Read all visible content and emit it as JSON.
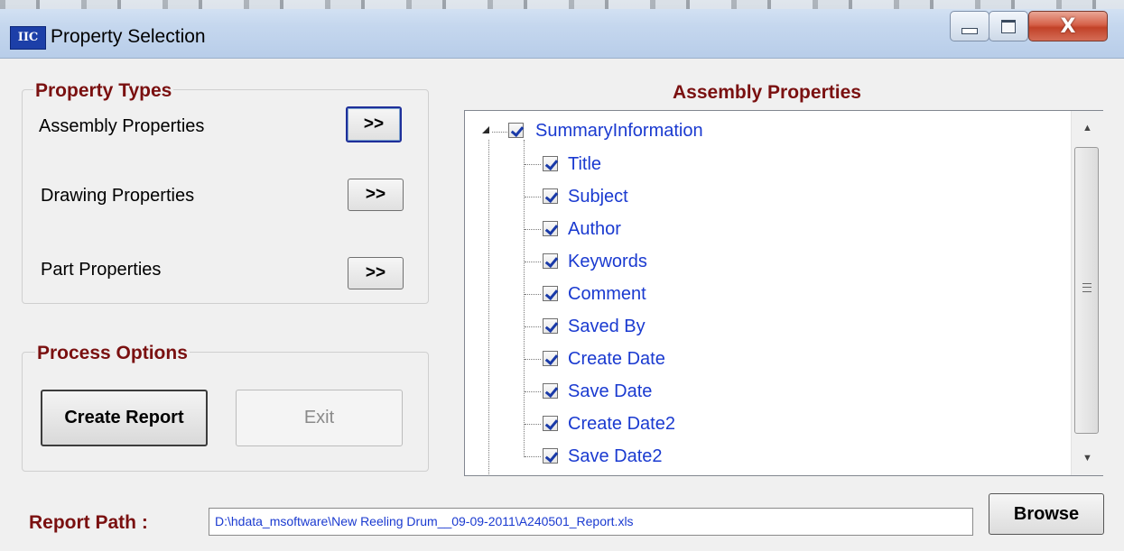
{
  "window": {
    "icon_text": "IIC",
    "title": "Property Selection",
    "close_glyph": "X"
  },
  "property_types": {
    "legend": "Property Types",
    "rows": [
      {
        "label": "Assembly Properties",
        "button": ">>"
      },
      {
        "label": "Drawing Properties",
        "button": ">>"
      },
      {
        "label": "Part Properties",
        "button": ">>"
      }
    ]
  },
  "process_options": {
    "legend": "Process Options",
    "create_report": "Create Report",
    "exit": "Exit"
  },
  "assembly_properties": {
    "title": "Assembly Properties",
    "root": {
      "label": "SummaryInformation",
      "checked": true,
      "expanded": true
    },
    "children": [
      {
        "label": "Title",
        "checked": true
      },
      {
        "label": "Subject",
        "checked": true
      },
      {
        "label": "Author",
        "checked": true
      },
      {
        "label": "Keywords",
        "checked": true
      },
      {
        "label": "Comment",
        "checked": true
      },
      {
        "label": "Saved By",
        "checked": true
      },
      {
        "label": "Create Date",
        "checked": true
      },
      {
        "label": "Save Date",
        "checked": true
      },
      {
        "label": "Create Date2",
        "checked": true
      },
      {
        "label": "Save Date2",
        "checked": true
      }
    ]
  },
  "report_path": {
    "label": "Report Path :",
    "value": "D:\\hdata_msoftware\\New Reeling Drum__09-09-2011\\A240501_Report.xls",
    "browse": "Browse"
  },
  "colors": {
    "heading": "#7a1010",
    "tree_text": "#1a3ad0",
    "path_text": "#1a3ad0"
  }
}
